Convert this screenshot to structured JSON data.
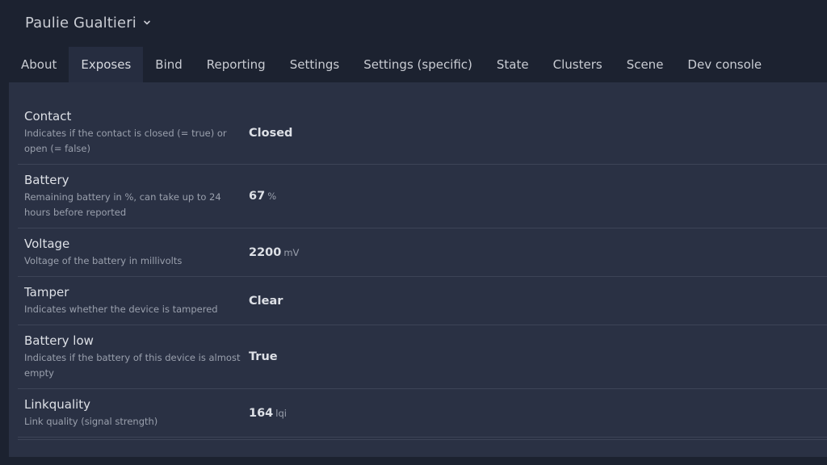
{
  "device": {
    "name": "Paulie Gualtieri"
  },
  "tabs": [
    {
      "label": "About"
    },
    {
      "label": "Exposes",
      "active": true
    },
    {
      "label": "Bind"
    },
    {
      "label": "Reporting"
    },
    {
      "label": "Settings"
    },
    {
      "label": "Settings (specific)"
    },
    {
      "label": "State"
    },
    {
      "label": "Clusters"
    },
    {
      "label": "Scene"
    },
    {
      "label": "Dev console"
    }
  ],
  "exposes": [
    {
      "title": "Contact",
      "description": "Indicates if the contact is closed (= true) or open (= false)",
      "value": "Closed",
      "unit": ""
    },
    {
      "title": "Battery",
      "description": "Remaining battery in %, can take up to 24 hours before reported",
      "value": "67",
      "unit": "%"
    },
    {
      "title": "Voltage",
      "description": "Voltage of the battery in millivolts",
      "value": "2200",
      "unit": "mV"
    },
    {
      "title": "Tamper",
      "description": "Indicates whether the device is tampered",
      "value": "Clear",
      "unit": ""
    },
    {
      "title": "Battery low",
      "description": "Indicates if the battery of this device is almost empty",
      "value": "True",
      "unit": ""
    },
    {
      "title": "Linkquality",
      "description": "Link quality (signal strength)",
      "value": "164",
      "unit": "lqi"
    }
  ],
  "colors": {
    "background": "#1c2230",
    "panel": "#2a3144",
    "active_tab": "#262d40",
    "divider": "#3d4457"
  },
  "icons": {
    "device_dropdown": "chevron-down-icon"
  }
}
